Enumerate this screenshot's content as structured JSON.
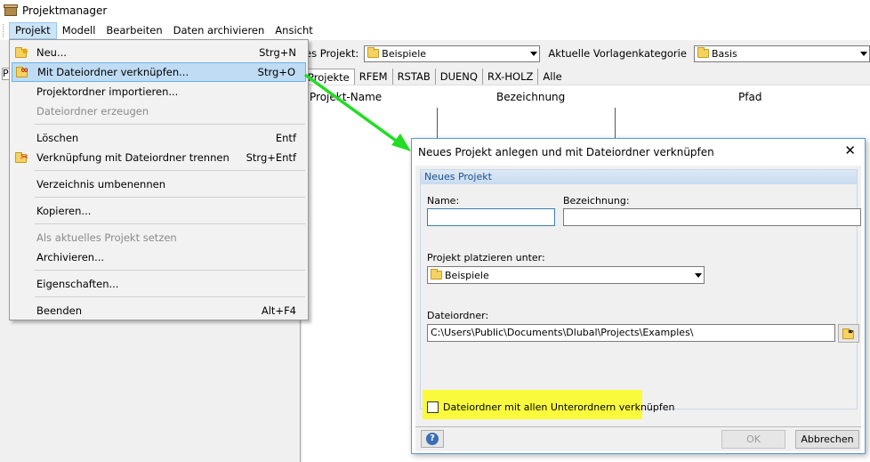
{
  "app": {
    "title": "Projektmanager"
  },
  "menubar": [
    "Projekt",
    "Modell",
    "Bearbeiten",
    "Daten archivieren",
    "Ansicht"
  ],
  "toolbar": {
    "current_project_label": "es Projekt:",
    "current_project_value": "Beispiele",
    "template_label": "Aktuelle Vorlagenkategorie",
    "template_value": "Basis"
  },
  "tabs": [
    "Projekte",
    "RFEM",
    "RSTAB",
    "DUENQ",
    "RX-HOLZ",
    "Alle"
  ],
  "list_columns": [
    "Projekt-Name",
    "Bezeichnung",
    "Pfad"
  ],
  "tree_stub": "P",
  "dropdown": {
    "items": [
      {
        "label": "Neu...",
        "shortcut": "Strg+N"
      },
      {
        "label": "Mit Dateiordner verknüpfen...",
        "shortcut": "Strg+O"
      },
      {
        "label": "Projektordner importieren..."
      },
      {
        "label": "Dateiordner erzeugen"
      },
      {
        "label": "Löschen",
        "shortcut": "Entf"
      },
      {
        "label": "Verknüpfung mit Dateiordner trennen",
        "shortcut": "Strg+Entf"
      },
      {
        "label": "Verzeichnis umbenennen"
      },
      {
        "label": "Kopieren..."
      },
      {
        "label": "Als aktuelles Projekt setzen"
      },
      {
        "label": "Archivieren..."
      },
      {
        "label": "Eigenschaften..."
      },
      {
        "label": "Beenden",
        "shortcut": "Alt+F4"
      }
    ]
  },
  "dialog": {
    "title": "Neues Projekt anlegen und mit Dateiordner verknüpfen",
    "close": "✕",
    "group_title": "Neues Projekt",
    "name_label": "Name:",
    "name_value": "",
    "desc_label": "Bezeichnung:",
    "desc_value": "",
    "place_label": "Projekt platzieren unter:",
    "place_value": "Beispiele",
    "folder_label": "Dateiordner:",
    "folder_value": "C:\\Users\\Public\\Documents\\Dlubal\\Projects\\Examples\\",
    "checkbox_label": "Dateiordner mit allen Unterordnern verknüpfen",
    "help": "?",
    "ok": "OK",
    "cancel": "Abbrechen"
  },
  "colors": {
    "highlight": "#fafa3c",
    "arrow": "#22dd22",
    "hover": "#bfdcf4"
  }
}
